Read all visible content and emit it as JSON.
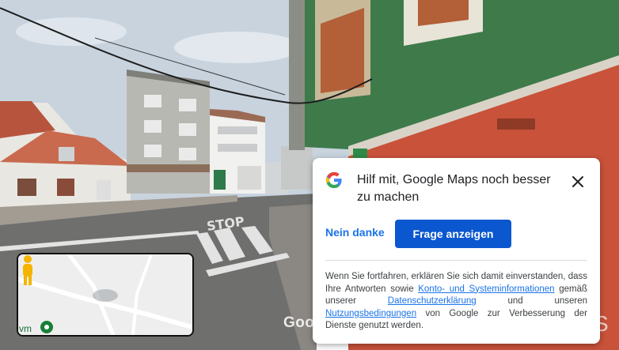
{
  "scene": {
    "watermark": "Google",
    "watermark_trail": "S",
    "road_marking": "STOP"
  },
  "minimap": {
    "label": "vm",
    "pin_icon": "location-pin-icon",
    "person_icon": "pegman-icon"
  },
  "dialog": {
    "title": "Hilf mit, Google Maps noch besser zu machen",
    "close_icon": "close-icon",
    "decline_label": "Nein danke",
    "primary_label": "Frage anzeigen",
    "fineprint": {
      "p1": "Wenn Sie fortfahren, erklären Sie sich damit einverstanden, dass Ihre Antworten sowie ",
      "link1": "Konto- und Systeminformationen",
      "p2": " gemäß unserer ",
      "link2": "Datenschutzerklärung",
      "p3": " und unseren ",
      "link3": "Nutzungsbedingungen",
      "p4": " von Google zur Verbesserung der Dienste genutzt werden."
    }
  },
  "colors": {
    "primary": "#0b57d0",
    "link": "#1a73e8",
    "text": "#202124"
  }
}
